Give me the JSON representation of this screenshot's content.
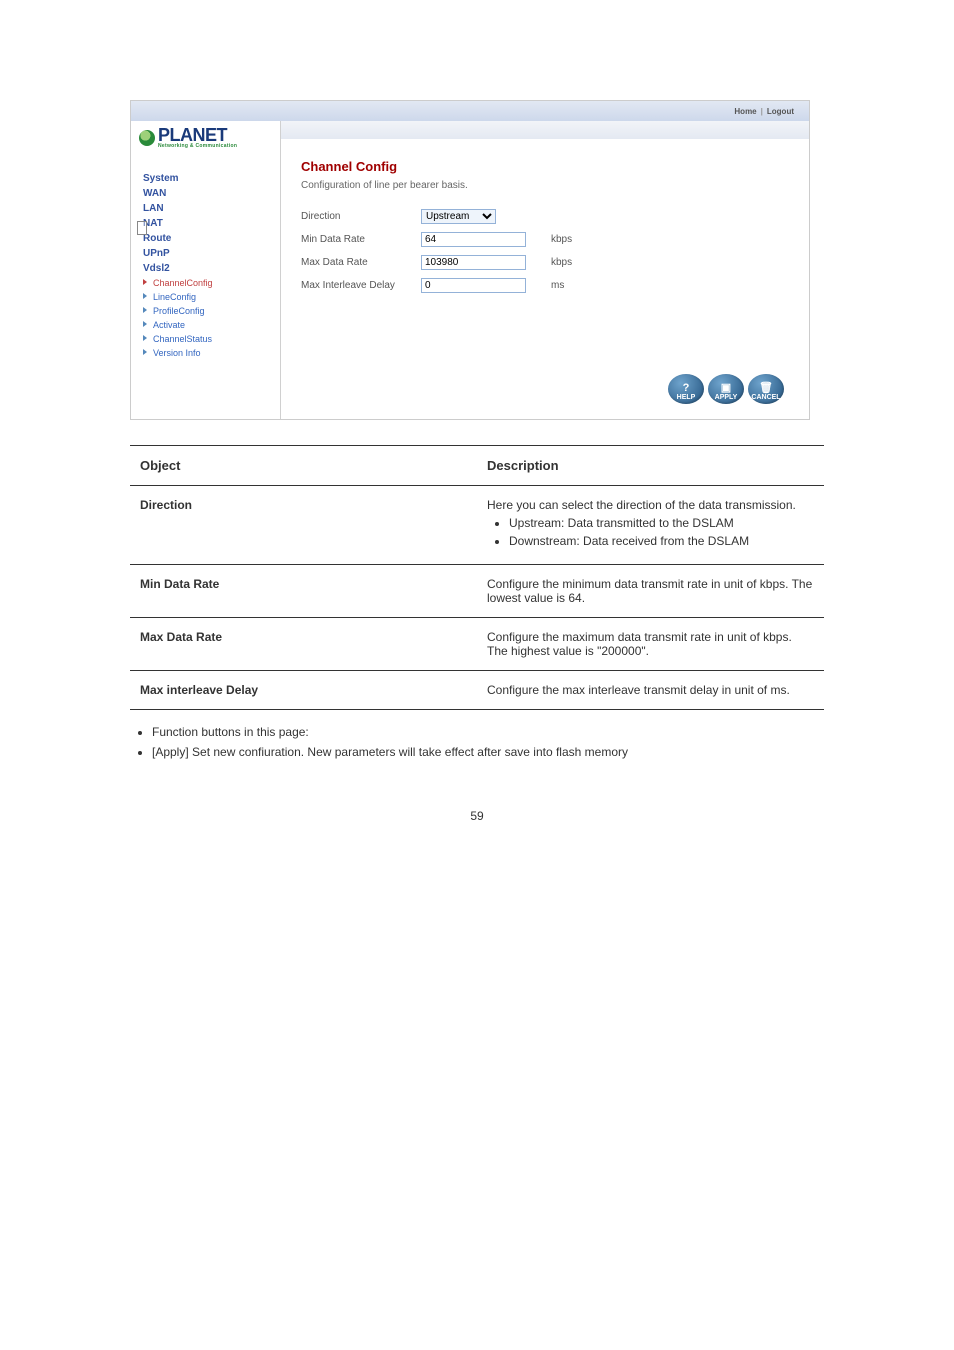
{
  "brand": {
    "name": "PLANET",
    "tagline": "Networking & Communication"
  },
  "topbar": {
    "home": "Home",
    "logout": "Logout"
  },
  "menu": {
    "system": "System",
    "wan": "WAN",
    "lan": "LAN",
    "nat": "NAT",
    "route": "Route",
    "upnp": "UPnP",
    "vdsl2": "Vdsl2",
    "sub": {
      "channelconfig": "ChannelConfig",
      "lineconfig": "LineConfig",
      "profileconfig": "ProfileConfig",
      "activate": "Activate",
      "channelstatus": "ChannelStatus",
      "versioninfo": "Version Info"
    }
  },
  "content": {
    "title": "Channel Config",
    "desc": "Configuration of line per bearer basis.",
    "rows": {
      "direction": {
        "label": "Direction",
        "value": "Upstream"
      },
      "minrate": {
        "label": "Min Data Rate",
        "value": "64",
        "unit": "kbps"
      },
      "maxrate": {
        "label": "Max Data Rate",
        "value": "103980",
        "unit": "kbps"
      },
      "maxdelay": {
        "label": "Max Interleave Delay",
        "value": "0",
        "unit": "ms"
      }
    },
    "buttons": {
      "help": "HELP",
      "apply": "APPLY",
      "cancel": "CANCEL"
    }
  },
  "reftable": {
    "head": {
      "object": "Object",
      "desc": "Description"
    },
    "rows": {
      "direction": {
        "obj": "Direction",
        "intro": "Here you can select the direction of the data transmission.",
        "bullets": [
          "Upstream: Data transmitted to the DSLAM",
          "Downstream: Data received from the DSLAM"
        ]
      },
      "minrate": {
        "obj": "Min Data Rate",
        "text": "Configure the minimum data transmit rate in unit of kbps. The lowest value is 64."
      },
      "maxrate": {
        "obj": "Max Data Rate",
        "text": "Configure the maximum data transmit rate in unit of kbps. The highest value is \"200000\"."
      },
      "maxdelay": {
        "obj": "Max interleave Delay",
        "text": "Configure the max interleave transmit delay in unit of ms."
      }
    }
  },
  "notes": {
    "n1": "Function buttons in this page:",
    "n2": "[Apply] Set new confiuration. New parameters will take effect after save into flash memory"
  },
  "page_number": "59"
}
